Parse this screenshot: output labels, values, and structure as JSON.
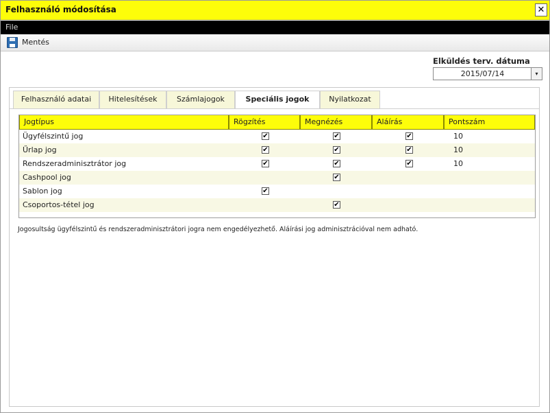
{
  "window": {
    "title": "Felhasználó módosítása",
    "close_label": "✕"
  },
  "menu": {
    "file_label": "File"
  },
  "toolbar": {
    "save_label": "Mentés"
  },
  "date": {
    "label": "Elküldés terv. dátuma",
    "value": "2015/07/14",
    "dropdown_glyph": "▾"
  },
  "tabs": [
    {
      "label": "Felhasználó adatai",
      "active": false
    },
    {
      "label": "Hitelesítések",
      "active": false
    },
    {
      "label": "Számlajogok",
      "active": false
    },
    {
      "label": "Speciális jogok",
      "active": true
    },
    {
      "label": "Nyilatkozat",
      "active": false
    }
  ],
  "grid": {
    "columns": [
      "Jogtípus",
      "Rögzítés",
      "Megnézés",
      "Aláírás",
      "Pontszám"
    ],
    "rows": [
      {
        "name": "Ügyfélszintű jog",
        "rogzites": true,
        "megnezes": true,
        "alairas": true,
        "pontszam": "10"
      },
      {
        "name": "Űrlap jog",
        "rogzites": true,
        "megnezes": true,
        "alairas": true,
        "pontszam": "10"
      },
      {
        "name": "Rendszeradminisztrátor jog",
        "rogzites": true,
        "megnezes": true,
        "alairas": true,
        "pontszam": "10"
      },
      {
        "name": "Cashpool jog",
        "rogzites": false,
        "megnezes": true,
        "alairas": false,
        "pontszam": ""
      },
      {
        "name": "Sablon jog",
        "rogzites": true,
        "megnezes": false,
        "alairas": false,
        "pontszam": ""
      },
      {
        "name": "Csoportos-tétel jog",
        "rogzites": false,
        "megnezes": true,
        "alairas": false,
        "pontszam": ""
      }
    ]
  },
  "note": "Jogosultság ügyfélszintű és rendszeradminisztrátori jogra nem engedélyezhető. Aláírási jog adminisztrációval nem adható.",
  "colors": {
    "accent_yellow": "#fdfd0a",
    "menubar": "#000000",
    "row_alt": "#f8f8e4"
  },
  "icons": {
    "save": "floppy-disk-icon",
    "close": "close-icon",
    "dropdown": "chevron-down-icon",
    "check": "checkmark-icon"
  }
}
